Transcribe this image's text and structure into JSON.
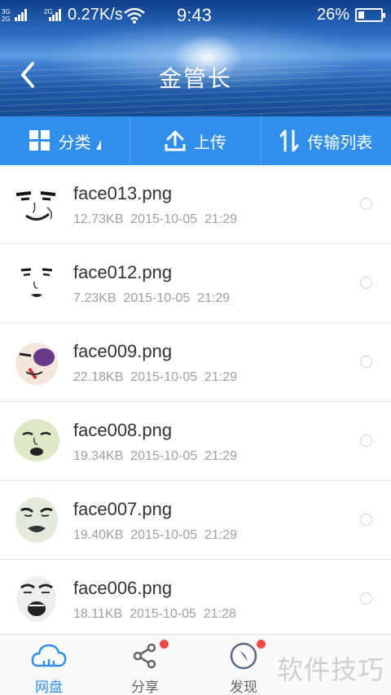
{
  "status_bar": {
    "net_top": "3G",
    "net_mid": "2G",
    "net_bottom": "2G",
    "speed": "0.27K/s",
    "time": "9:43",
    "battery": "26%"
  },
  "header": {
    "title": "金管长",
    "back_icon": "chevron-left-icon"
  },
  "toolbar": {
    "category_label": "分类",
    "upload_label": "上传",
    "transfer_label": "传输列表"
  },
  "files": [
    {
      "name": "face013.png",
      "size": "12.73KB",
      "date": "2015-10-05",
      "time": "21:29"
    },
    {
      "name": "face012.png",
      "size": "7.23KB",
      "date": "2015-10-05",
      "time": "21:29"
    },
    {
      "name": "face009.png",
      "size": "22.18KB",
      "date": "2015-10-05",
      "time": "21:29"
    },
    {
      "name": "face008.png",
      "size": "19.34KB",
      "date": "2015-10-05",
      "time": "21:29"
    },
    {
      "name": "face007.png",
      "size": "19.40KB",
      "date": "2015-10-05",
      "time": "21:29"
    },
    {
      "name": "face006.png",
      "size": "18.11KB",
      "date": "2015-10-05",
      "time": "21:28"
    }
  ],
  "bottom_nav": {
    "netdisk_label": "网盘",
    "share_label": "分享",
    "discover_label": "发现"
  },
  "watermark": "软件技巧",
  "colors": {
    "accent": "#2f8fea",
    "badge": "#f04a4a"
  }
}
